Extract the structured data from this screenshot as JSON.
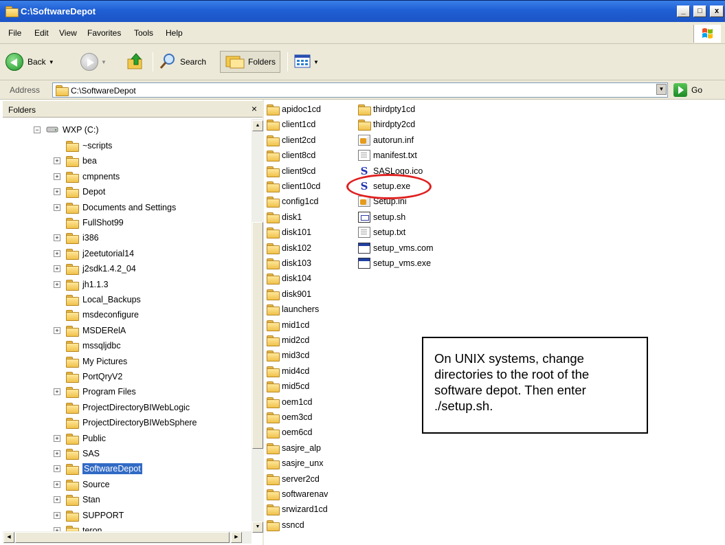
{
  "window": {
    "title": "C:\\SoftwareDepot"
  },
  "controls": {
    "minimize": "_",
    "maximize": "□",
    "close": "x"
  },
  "menu": [
    "File",
    "Edit",
    "View",
    "Favorites",
    "Tools",
    "Help"
  ],
  "toolbar": {
    "back_label": "Back",
    "search_label": "Search",
    "folders_label": "Folders"
  },
  "address": {
    "label": "Address",
    "value": "C:\\SoftwareDepot",
    "go_label": "Go"
  },
  "folders_pane": {
    "title": "Folders",
    "close": "×",
    "drive": "WXP (C:)",
    "items": [
      {
        "label": "~scripts",
        "expandable": false
      },
      {
        "label": "bea",
        "expandable": true
      },
      {
        "label": "cmpnents",
        "expandable": true
      },
      {
        "label": "Depot",
        "expandable": true
      },
      {
        "label": "Documents and Settings",
        "expandable": true
      },
      {
        "label": "FullShot99",
        "expandable": false
      },
      {
        "label": "i386",
        "expandable": true
      },
      {
        "label": "j2eetutorial14",
        "expandable": true
      },
      {
        "label": "j2sdk1.4.2_04",
        "expandable": true
      },
      {
        "label": "jh1.1.3",
        "expandable": true
      },
      {
        "label": "Local_Backups",
        "expandable": false
      },
      {
        "label": "msdeconfigure",
        "expandable": false
      },
      {
        "label": "MSDERelA",
        "expandable": true
      },
      {
        "label": "mssqljdbc",
        "expandable": false
      },
      {
        "label": "My Pictures",
        "expandable": false
      },
      {
        "label": "PortQryV2",
        "expandable": false
      },
      {
        "label": "Program Files",
        "expandable": true
      },
      {
        "label": "ProjectDirectoryBIWebLogic",
        "expandable": false
      },
      {
        "label": "ProjectDirectoryBIWebSphere",
        "expandable": false
      },
      {
        "label": "Public",
        "expandable": true
      },
      {
        "label": "SAS",
        "expandable": true
      },
      {
        "label": "SoftwareDepot",
        "expandable": true,
        "selected": true
      },
      {
        "label": "Source",
        "expandable": true
      },
      {
        "label": "Stan",
        "expandable": true
      },
      {
        "label": "SUPPORT",
        "expandable": true
      },
      {
        "label": "teron",
        "expandable": true
      }
    ]
  },
  "files": {
    "column1": [
      "apidoc1cd",
      "client1cd",
      "client2cd",
      "client8cd",
      "client9cd",
      "client10cd",
      "config1cd",
      "disk1",
      "disk101",
      "disk102",
      "disk103",
      "disk104",
      "disk901",
      "launchers",
      "mid1cd",
      "mid2cd",
      "mid3cd",
      "mid4cd",
      "mid5cd",
      "oem1cd",
      "oem3cd",
      "oem6cd",
      "sasjre_alp",
      "sasjre_unx",
      "server2cd",
      "softwarenav",
      "srwizard1cd",
      "ssncd"
    ],
    "column2": [
      {
        "label": "thirdpty1cd",
        "icon": "folder-icon"
      },
      {
        "label": "thirdpty2cd",
        "icon": "folder-icon"
      },
      {
        "label": "autorun.inf",
        "icon": "setup-info-icon"
      },
      {
        "label": "manifest.txt",
        "icon": "text-file-icon"
      },
      {
        "label": "SASLogo.ico",
        "icon": "sas-logo-icon"
      },
      {
        "label": "setup.exe",
        "icon": "sas-logo-icon"
      },
      {
        "label": "Setup.ini",
        "icon": "setup-info-icon"
      },
      {
        "label": "setup.sh",
        "icon": "shell-script-icon"
      },
      {
        "label": "setup.txt",
        "icon": "text-file-icon"
      },
      {
        "label": "setup_vms.com",
        "icon": "window-app-icon"
      },
      {
        "label": "setup_vms.exe",
        "icon": "window-app-icon"
      }
    ]
  },
  "callout": {
    "text": "On UNIX systems, change directories to the root of the software depot.  Then enter ./setup.sh."
  },
  "colors": {
    "titlebar": "#1f5fd4",
    "selection": "#316ac5",
    "highlight_ring": "#e02020"
  }
}
